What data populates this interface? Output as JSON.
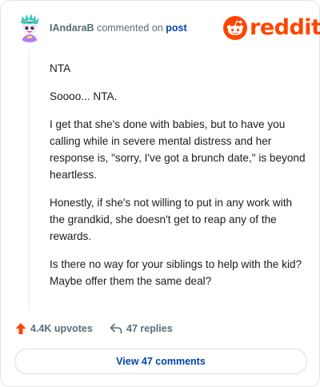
{
  "header": {
    "username": "IAndaraB",
    "verb": "commented on",
    "post_link": "post",
    "brand": "reddit"
  },
  "comment": {
    "paragraphs": [
      "NTA",
      "Soooo... NTA.",
      "I get that she's done with babies, but to have you calling while in severe mental distress and her response is, \"sorry, I've got a brunch date,\" is beyond heartless.",
      "Honestly, if she's not willing to put in any work with the grandkid, she doesn't get to reap any of the rewards.",
      "Is there no way for your siblings to help with the kid? Maybe offer them the same deal?"
    ]
  },
  "actions": {
    "upvotes_label": "4.4K upvotes",
    "replies_label": "47 replies",
    "view_comments_label": "View 47 comments"
  },
  "colors": {
    "brand": "#ff4500",
    "link": "#0045ac",
    "meta": "#576f76",
    "upvote": "#ff4500"
  },
  "icons": {
    "upvote": "upvote-arrow-icon",
    "reply": "reply-arrow-icon",
    "logo": "reddit-snoo-icon"
  }
}
